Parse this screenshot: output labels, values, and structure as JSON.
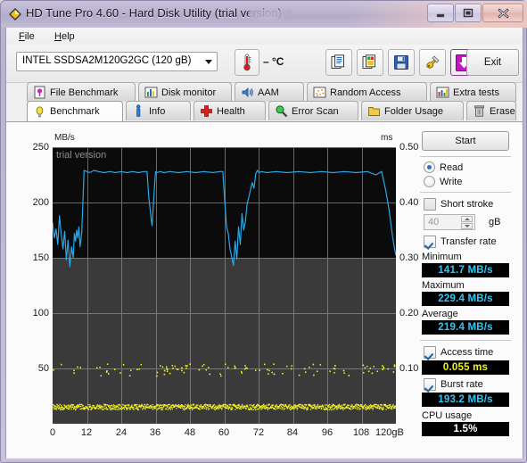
{
  "window": {
    "title": "HD Tune Pro 4.60 - Hard Disk Utility (trial version)",
    "app_icon": "diamond-app-icon",
    "minimize_label": "Minimize",
    "maximize_label": "Maximize",
    "close_label": "Close"
  },
  "menu": {
    "items": [
      {
        "label": "File",
        "accel": "F"
      },
      {
        "label": "Help",
        "accel": "H"
      }
    ]
  },
  "toolbar": {
    "drive_selected": "INTEL SSDSA2M120G2GC (120 gB)",
    "temperature": "– °C",
    "temp_icon": "thermometer-icon",
    "buttons": [
      {
        "name": "copy-button",
        "icon": "copy-pages-icon"
      },
      {
        "name": "copy-image-button",
        "icon": "copy-image-icon"
      },
      {
        "name": "save-button",
        "icon": "floppy-save-icon"
      },
      {
        "name": "settings-button",
        "icon": "plug-settings-icon"
      },
      {
        "name": "download-button",
        "icon": "purple-down-arrow-icon"
      }
    ],
    "exit_label": "Exit"
  },
  "tabs": {
    "row1": [
      {
        "label": "File Benchmark",
        "icon": "file-benchmark-icon",
        "active": false
      },
      {
        "label": "Disk monitor",
        "icon": "bar-chart-icon",
        "active": false
      },
      {
        "label": "AAM",
        "icon": "speaker-icon",
        "active": false
      },
      {
        "label": "Random Access",
        "icon": "scatter-icon",
        "active": false
      },
      {
        "label": "Extra tests",
        "icon": "grid-chart-icon",
        "active": false
      }
    ],
    "row2": [
      {
        "label": "Benchmark",
        "icon": "bulb-icon",
        "active": true
      },
      {
        "label": "Info",
        "icon": "info-icon",
        "active": false
      },
      {
        "label": "Health",
        "icon": "red-cross-icon",
        "active": false
      },
      {
        "label": "Error Scan",
        "icon": "magnifier-icon",
        "active": false
      },
      {
        "label": "Folder Usage",
        "icon": "folder-icon",
        "active": false
      },
      {
        "label": "Erase",
        "icon": "trash-icon",
        "active": false
      }
    ]
  },
  "results": {
    "start_label": "Start",
    "mode_read_label": "Read",
    "mode_write_label": "Write",
    "mode_selected": "Read",
    "short_stroke_label": "Short stroke",
    "short_stroke_checked": false,
    "short_stroke_value": "40",
    "short_stroke_unit": "gB",
    "transfer_rate_label": "Transfer rate",
    "transfer_rate_checked": true,
    "minimum_label": "Minimum",
    "minimum_value": "141.7 MB/s",
    "maximum_label": "Maximum",
    "maximum_value": "229.4 MB/s",
    "average_label": "Average",
    "average_value": "219.4 MB/s",
    "access_time_label": "Access time",
    "access_time_checked": true,
    "access_time_value": "0.055 ms",
    "burst_rate_label": "Burst rate",
    "burst_rate_checked": true,
    "burst_rate_value": "193.2 MB/s",
    "cpu_usage_label": "CPU usage",
    "cpu_usage_value": "1.5%"
  },
  "colors": {
    "transfer_line": "#2aa7e8",
    "access_dots": "#f5f51e",
    "plot_bg": "#3a3a3a",
    "plot_bg_top": "#0b0b0b",
    "grid": "#8a8a8a",
    "value_cyan": "#2ec8f5",
    "value_yellow": "#f2f21e"
  },
  "chart_data": {
    "type": "line",
    "title": "",
    "watermark": "trial version",
    "ylabel": "MB/s",
    "y2label": "ms",
    "xlabel": "gB",
    "ylim": [
      0,
      250
    ],
    "y2lim": [
      0,
      0.5
    ],
    "xlim": [
      0,
      120
    ],
    "yticks": [
      0,
      50,
      100,
      150,
      200,
      250
    ],
    "ytick_labels": [
      "",
      "50",
      "100",
      "150",
      "200",
      "250"
    ],
    "y2ticks": [
      0.1,
      0.2,
      0.3,
      0.4,
      0.5
    ],
    "y2tick_labels": [
      "0.10",
      "0.20",
      "0.30",
      "0.40",
      "0.50"
    ],
    "xticks": [
      0,
      12,
      24,
      36,
      48,
      60,
      72,
      84,
      96,
      108,
      120
    ],
    "xtick_labels": [
      "0",
      "12",
      "24",
      "36",
      "48",
      "60",
      "72",
      "84",
      "96",
      "108",
      "120gB"
    ],
    "grid": true,
    "legend": "none",
    "series": [
      {
        "name": "Transfer rate",
        "unit": "MB/s",
        "axis": "left",
        "color": "#2aa7e8",
        "x": [
          0.0,
          0.6,
          1.2,
          1.8,
          2.4,
          3.0,
          3.6,
          4.2,
          4.8,
          5.4,
          6.0,
          6.6,
          7.2,
          7.6,
          8.0,
          8.4,
          8.8,
          9.2,
          9.6,
          10.2,
          11.0,
          12.0,
          13.0,
          14.5,
          16.0,
          18.0,
          20.0,
          22.0,
          24.0,
          26.0,
          28.0,
          30.0,
          32.0,
          33.0,
          33.6,
          34.0,
          34.4,
          34.8,
          35.2,
          35.6,
          36.0,
          36.5,
          37.5,
          39.0,
          41.0,
          44.0,
          47.0,
          50.0,
          53.0,
          56.0,
          58.5,
          59.5,
          60.2,
          60.8,
          61.4,
          62.0,
          62.6,
          63.2,
          63.8,
          64.4,
          65.0,
          65.6,
          66.2,
          66.8,
          67.4,
          68.0,
          68.6,
          69.2,
          69.8,
          70.4,
          71.0,
          71.6,
          72.2,
          73.0,
          75.0,
          78.0,
          82.0,
          86.0,
          90.0,
          94.0,
          98.0,
          102.0,
          106.0,
          110.0,
          113.0,
          115.0,
          116.5,
          117.5,
          118.2,
          118.8,
          119.4,
          120.0
        ],
        "y": [
          182,
          168,
          176,
          162,
          188,
          172,
          158,
          174,
          148,
          166,
          142,
          160,
          150,
          172,
          165,
          175,
          168,
          178,
          160,
          173,
          229,
          228,
          227,
          229,
          228,
          227,
          228,
          227,
          228,
          227,
          228,
          227,
          228,
          228,
          205,
          196,
          186,
          179,
          197,
          214,
          228,
          227,
          228,
          227,
          228,
          227,
          228,
          227,
          228,
          227,
          228,
          228,
          200,
          178,
          172,
          158,
          151,
          143,
          165,
          149,
          178,
          162,
          190,
          175,
          183,
          199,
          205,
          212,
          218,
          213,
          226,
          229,
          227,
          228,
          227,
          228,
          227,
          228,
          227,
          228,
          227,
          228,
          227,
          228,
          225,
          228,
          210,
          195,
          182,
          170,
          160,
          152
        ]
      },
      {
        "name": "Access time",
        "unit": "ms",
        "axis": "right",
        "color": "#f5f51e",
        "style": "scatter",
        "mean_ms": 0.055,
        "cluster_low_ms": 0.031,
        "cluster_high_ms": 0.098,
        "description": "Dense band of points near 0.031 ms across the full 0-120 gB span plus a sparse scattered band near 0.095-0.105 ms"
      }
    ],
    "annotations": [
      {
        "text": "Minimum 141.7 MB/s"
      },
      {
        "text": "Maximum 229.4 MB/s"
      },
      {
        "text": "Average 219.4 MB/s"
      },
      {
        "text": "Access time 0.055 ms"
      },
      {
        "text": "Burst rate 193.2 MB/s"
      },
      {
        "text": "CPU usage 1.5%"
      }
    ]
  }
}
